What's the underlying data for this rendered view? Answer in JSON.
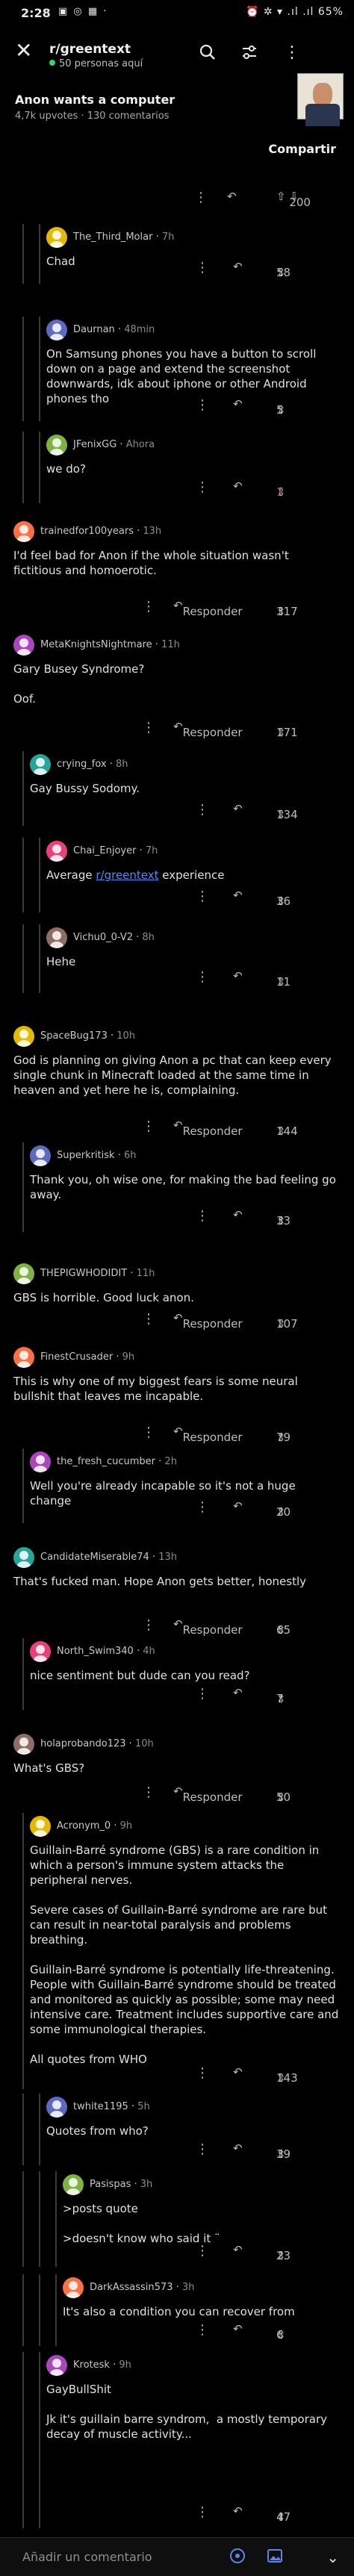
{
  "status_bar": {
    "time": "2:28",
    "icons": "▣ ◎ ▦ ·",
    "right": "⏰ ✲ ▾ .ıl .ıl 65%"
  },
  "header": {
    "subreddit": "r/greentext",
    "online": "50 personas aquí",
    "close": "✕",
    "search": "⌕",
    "sort": "⚙",
    "more": "⋮"
  },
  "post": {
    "title": "Anon wants a computer",
    "meta": "4,7k upvotes · 130 comentarios",
    "share": "Compartir"
  },
  "top_actions": {
    "dots": "⋮",
    "reply": "↶",
    "votes": "200"
  },
  "reply_label": "Responder",
  "comments": [
    {
      "id": "third_molar",
      "user": "The_Third_Molar",
      "ago": "7h",
      "body": "Chad",
      "votes": "58"
    },
    {
      "id": "daurnan",
      "user": "Daurnan",
      "ago": "48min",
      "body": "On Samsung phones you have a button to scroll down on a page and extend the screenshot downwards, idk about iphone or other Android phones tho",
      "votes": "5"
    },
    {
      "id": "jfenix",
      "user": "JFenixGG",
      "ago": "Ahora",
      "body": "we do?",
      "votes": "1"
    },
    {
      "id": "trained",
      "user": "trainedfor100years",
      "ago": "13h",
      "body": "I'd feel bad for Anon if the whole situation wasn't fictitious and homoerotic.",
      "votes": "317"
    },
    {
      "id": "metaknights",
      "user": "MetaKnightsNightmare",
      "ago": "11h",
      "body": "Gary Busey Syndrome?\n\nOof.",
      "votes": "171"
    },
    {
      "id": "crying_fox",
      "user": "crying_fox",
      "ago": "8h",
      "body": "Gay Bussy Sodomy.",
      "votes": "134"
    },
    {
      "id": "chai",
      "user": "Chai_Enjoyer",
      "ago": "7h",
      "body_pre": "Average ",
      "body_link": "r/greentext",
      "body_post": " experience",
      "votes": "36"
    },
    {
      "id": "vichu",
      "user": "Vichu0_0-V2",
      "ago": "8h",
      "body": "Hehe",
      "votes": "11"
    },
    {
      "id": "spacebug",
      "user": "SpaceBug173",
      "ago": "10h",
      "body": "God is planning on giving Anon a pc that can keep every single chunk in Minecraft loaded at the same time in heaven and yet here he is, complaining.",
      "votes": "144"
    },
    {
      "id": "superkritisk",
      "user": "Superkritisk",
      "ago": "6h",
      "body": "Thank you, oh wise one, for making the bad feeling go away.",
      "votes": "33"
    },
    {
      "id": "thepig",
      "user": "THEPIGWHODIDIT",
      "ago": "11h",
      "body": "GBS is horrible. Good luck anon.",
      "votes": "107"
    },
    {
      "id": "finest",
      "user": "FinestCrusader",
      "ago": "9h",
      "body": "This is why one of my biggest fears is some neural bullshit that leaves me incapable.",
      "votes": "79"
    },
    {
      "id": "fresh",
      "user": "the_fresh_cucumber",
      "ago": "2h",
      "body": "Well you're already incapable so it's not a huge change",
      "votes": "20"
    },
    {
      "id": "candidate",
      "user": "CandidateMiserable74",
      "ago": "13h",
      "body": "That's fucked man. Hope Anon gets better, honestly",
      "votes": "65"
    },
    {
      "id": "northswim",
      "user": "North_Swim340",
      "ago": "4h",
      "body": "nice sentiment but dude can you read?",
      "votes": "7"
    },
    {
      "id": "holaprobando",
      "user": "holaprobando123",
      "ago": "10h",
      "body": "What's GBS?",
      "votes": "50"
    },
    {
      "id": "acronym",
      "user": "Acronym_0",
      "ago": "9h",
      "body": "Guillain-Barré syndrome (GBS) is a rare condition in which a person's immune system attacks the peripheral nerves.\n\nSevere cases of Guillain-Barré syndrome are rare but can result in near-total paralysis and problems breathing.\n\nGuillain-Barré syndrome is potentially life-threatening. People with Guillain-Barré syndrome should be treated and monitored as quickly as possible; some may need intensive care. Treatment includes supportive care and some immunological therapies.\n\nAll quotes from WHO",
      "votes": "143"
    },
    {
      "id": "twhite",
      "user": "twhite1195",
      "ago": "5h",
      "body": "Quotes from who?",
      "votes": "39"
    },
    {
      "id": "pasispas",
      "user": "Pasispas",
      "ago": "3h",
      "body": ">posts quote\n\n>doesn't know who said it ¨",
      "votes": "23"
    },
    {
      "id": "darkassassin",
      "user": "DarkAssassin573",
      "ago": "3h",
      "body": "It's also a condition you can recover from",
      "votes": "6"
    },
    {
      "id": "krotesk",
      "user": "Krotesk",
      "ago": "9h",
      "body": "GayBullShit\n\nJk it's guillain barre syndrom,  a mostly temporary decay of muscle activity...",
      "votes": "47"
    }
  ],
  "bottom": {
    "placeholder": "Añadir un comentario",
    "chevron": "⌄"
  },
  "colors": {
    "accent": "#4f8ef7",
    "upvoted": "#e05a2a",
    "online": "#3ad36b"
  }
}
